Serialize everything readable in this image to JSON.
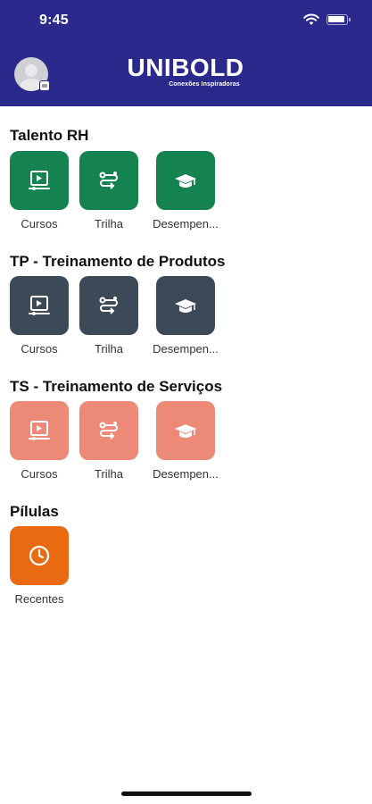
{
  "status_bar": {
    "time": "9:45"
  },
  "header": {
    "logo_text": "UNIBOLD",
    "logo_subtitle": "Conexões Inspiradoras"
  },
  "sections": [
    {
      "title": "Talento RH",
      "color": "#14834f",
      "items": [
        {
          "label": "Cursos",
          "icon": "video-lesson-icon"
        },
        {
          "label": "Trilha",
          "icon": "track-route-icon"
        },
        {
          "label": "Desempen...",
          "icon": "graduation-cap-icon"
        }
      ]
    },
    {
      "title": "TP - Treinamento de Produtos",
      "color": "#3c4a57",
      "items": [
        {
          "label": "Cursos",
          "icon": "video-lesson-icon"
        },
        {
          "label": "Trilha",
          "icon": "track-route-icon"
        },
        {
          "label": "Desempen...",
          "icon": "graduation-cap-icon"
        }
      ]
    },
    {
      "title": "TS - Treinamento de Serviços",
      "color": "#ed8977",
      "items": [
        {
          "label": "Cursos",
          "icon": "video-lesson-icon"
        },
        {
          "label": "Trilha",
          "icon": "track-route-icon"
        },
        {
          "label": "Desempen...",
          "icon": "graduation-cap-icon"
        }
      ]
    },
    {
      "title": "Pílulas",
      "color": "#ea6a12",
      "items": [
        {
          "label": "Recentes",
          "icon": "clock-icon"
        }
      ]
    }
  ],
  "colors": {
    "header_bg": "#2b2a8c",
    "page_bg": "#ffffff"
  }
}
